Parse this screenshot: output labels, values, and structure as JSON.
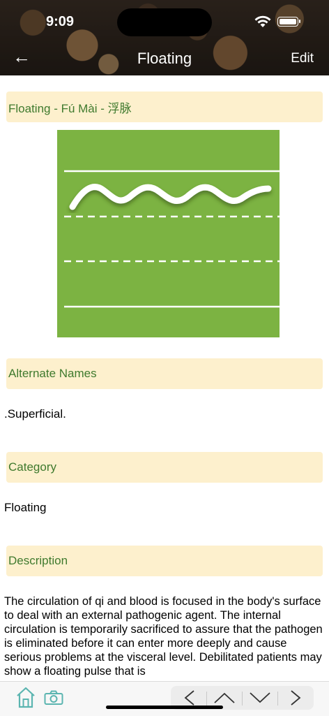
{
  "status_bar": {
    "time": "9:09"
  },
  "nav": {
    "title": "Floating",
    "edit_label": "Edit"
  },
  "pulse": {
    "heading": "Floating - Fú Mài - 浮脉",
    "diagram_color": "#7cb342"
  },
  "sections": [
    {
      "heading": "Alternate Names",
      "content": ".Superficial."
    },
    {
      "heading": "Category",
      "content": "Floating"
    },
    {
      "heading": "Description",
      "content": "The circulation of qi and blood is focused in the body's surface to deal with an external pathogenic agent. The internal circulation is temporarily sacrificed to assure that the pathogen is eliminated before it can enter more deeply and cause serious problems at the visceral level. Debilitated patients may show a floating pulse that is"
    }
  ],
  "colors": {
    "section_bg": "#fdf0cd",
    "section_text": "#3f7a2e",
    "accent_icon": "#5bb5b0"
  },
  "toolbar": {
    "icons": [
      "home-icon",
      "camera-icon",
      "chevron-left-icon",
      "chevron-up-icon",
      "chevron-down-icon",
      "chevron-right-icon"
    ]
  }
}
